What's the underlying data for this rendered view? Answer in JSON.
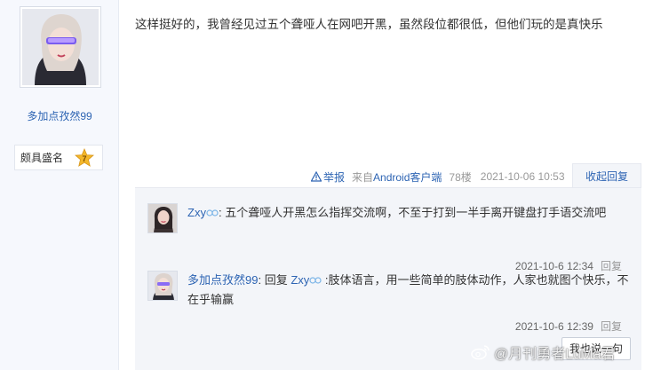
{
  "author": {
    "name": "多加点孜然99",
    "badge_label": "颇具盛名",
    "badge_level": "7"
  },
  "post": {
    "body": "这样挺好的，我曾经见过五个聋哑人在网吧开黑，虽然段位都很低，但他们玩的是真快乐",
    "report_label": "举报",
    "source_prefix": "来自",
    "source_link": "Android客户端",
    "floor": "78楼",
    "time": "2021-10-06 10:53",
    "collapse_label": "收起回复"
  },
  "replies": [
    {
      "user": "Zxy",
      "separator": ": ",
      "text": "五个聋哑人开黑怎么指挥交流啊，不至于打到一半手离开键盘打手语交流吧",
      "time": "2021-10-6 12:34",
      "reply_label": "回复"
    },
    {
      "user": "多加点孜然99",
      "separator": ": ",
      "reply_prefix": "回复 ",
      "reply_to": "Zxy",
      "text": " :肢体语言，用一些简单的肢体动作，人家也就图个快乐，不在乎输赢",
      "time": "2021-10-6 12:39",
      "reply_label": "回复"
    }
  ],
  "say_button": "我也说一句",
  "watermark": "@月刊勇者LuMa君",
  "colors": {
    "link": "#2d64b3",
    "meta": "#999999",
    "reply_bg": "#f3f5f9",
    "sidebar_bg": "#f6f8fd",
    "badge_gold": "#f3b72a"
  }
}
